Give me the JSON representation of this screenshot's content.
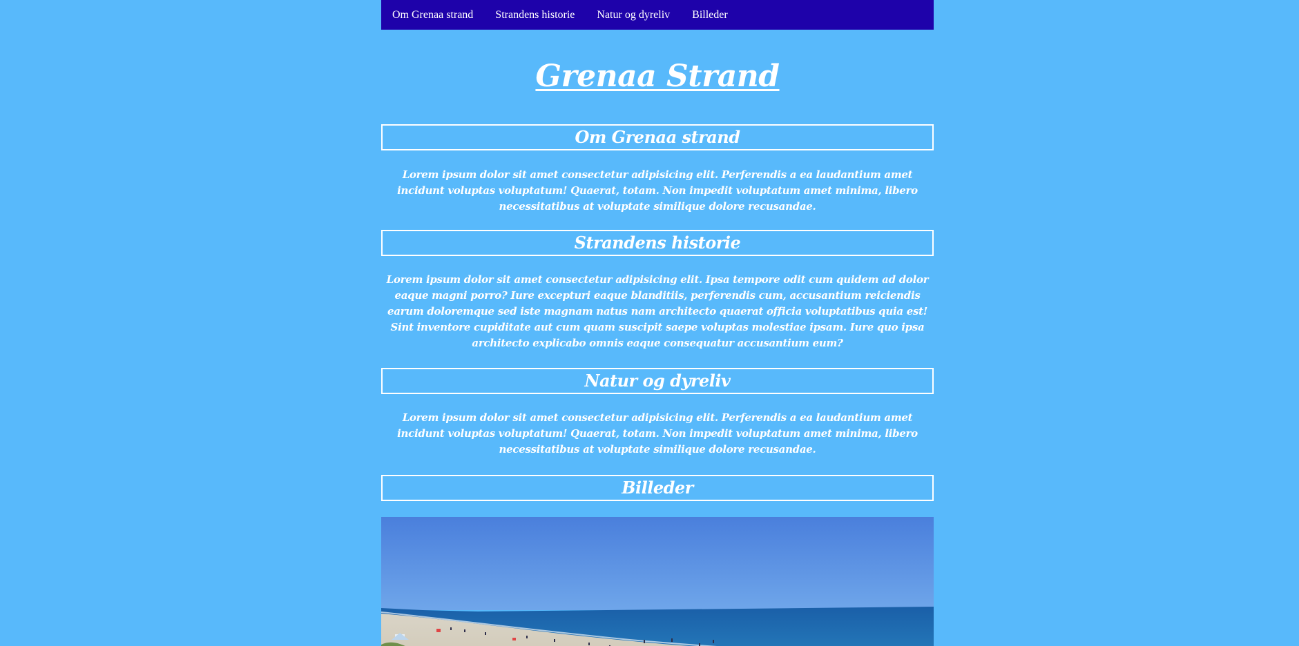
{
  "nav": {
    "items": [
      {
        "label": "Om Grenaa strand"
      },
      {
        "label": "Strandens historie"
      },
      {
        "label": "Natur og dyreliv"
      },
      {
        "label": "Billeder"
      }
    ]
  },
  "page": {
    "title": "Grenaa Strand"
  },
  "sections": [
    {
      "heading": "Om Grenaa strand",
      "text": "Lorem ipsum dolor sit amet consectetur adipisicing elit. Perferendis a ea laudantium amet incidunt voluptas voluptatum! Quaerat, totam. Non impedit voluptatum amet minima, libero necessitatibus at voluptate similique dolore recusandae."
    },
    {
      "heading": "Strandens historie",
      "text": "Lorem ipsum dolor sit amet consectetur adipisicing elit. Ipsa tempore odit cum quidem ad dolor eaque magni porro? Iure excepturi eaque blanditiis, perferendis cum, accusantium reiciendis earum doloremque sed iste magnam natus nam architecto quaerat officia voluptatibus quia est! Sint inventore cupiditate aut cum quam suscipit saepe voluptas molestiae ipsam. Iure quo ipsa architecto explicabo omnis eaque consequatur accusantium eum?"
    },
    {
      "heading": "Natur og dyreliv",
      "text": "Lorem ipsum dolor sit amet consectetur adipisicing elit. Perferendis a ea laudantium amet incidunt voluptas voluptatum! Quaerat, totam. Non impedit voluptatum amet minima, libero necessitatibus at voluptate similique dolore recusandae."
    },
    {
      "heading": "Billeder"
    }
  ],
  "colors": {
    "background": "#58b9fb",
    "nav_background": "#1e02aa",
    "text": "#ffffff"
  }
}
